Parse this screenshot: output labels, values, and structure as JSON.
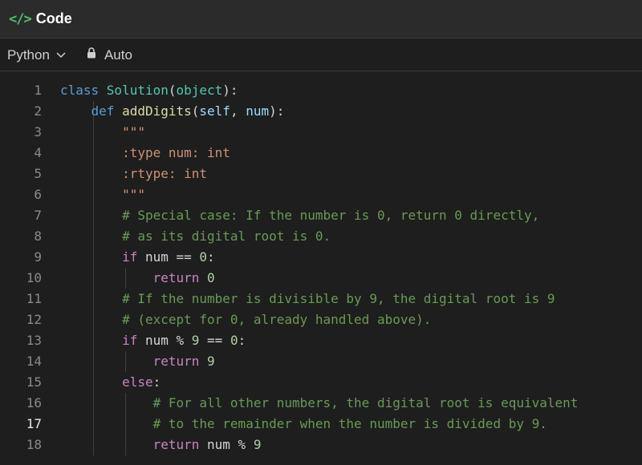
{
  "header": {
    "icon": "code-icon",
    "title": "Code"
  },
  "toolbar": {
    "language": "Python",
    "mode_label": "Auto"
  },
  "editor": {
    "active_line": 17,
    "lines": [
      {
        "n": "1",
        "tokens": [
          [
            "k",
            "class "
          ],
          [
            "cls",
            "Solution"
          ],
          [
            "pl",
            "("
          ],
          [
            "cls",
            "object"
          ],
          [
            "pl",
            "):"
          ]
        ]
      },
      {
        "n": "2",
        "tokens": [
          [
            "pl",
            "    "
          ],
          [
            "k",
            "def "
          ],
          [
            "fn",
            "addDigits"
          ],
          [
            "pl",
            "("
          ],
          [
            "pr",
            "self"
          ],
          [
            "pl",
            ", "
          ],
          [
            "pr",
            "num"
          ],
          [
            "pl",
            "):"
          ]
        ]
      },
      {
        "n": "3",
        "tokens": [
          [
            "pl",
            "        "
          ],
          [
            "str",
            "\"\"\""
          ]
        ]
      },
      {
        "n": "4",
        "tokens": [
          [
            "pl",
            "        "
          ],
          [
            "str",
            ":type num: int"
          ]
        ]
      },
      {
        "n": "5",
        "tokens": [
          [
            "pl",
            "        "
          ],
          [
            "str",
            ":rtype: int"
          ]
        ]
      },
      {
        "n": "6",
        "tokens": [
          [
            "pl",
            "        "
          ],
          [
            "str",
            "\"\"\""
          ]
        ]
      },
      {
        "n": "7",
        "tokens": [
          [
            "pl",
            "        "
          ],
          [
            "cm",
            "# Special case: If the number is 0, return 0 directly,"
          ]
        ]
      },
      {
        "n": "8",
        "tokens": [
          [
            "pl",
            "        "
          ],
          [
            "cm",
            "# as its digital root is 0."
          ]
        ]
      },
      {
        "n": "9",
        "tokens": [
          [
            "pl",
            "        "
          ],
          [
            "kw",
            "if"
          ],
          [
            "pl",
            " num == "
          ],
          [
            "num",
            "0"
          ],
          [
            "pl",
            ":"
          ]
        ]
      },
      {
        "n": "10",
        "tokens": [
          [
            "pl",
            "            "
          ],
          [
            "kw",
            "return "
          ],
          [
            "num",
            "0"
          ]
        ]
      },
      {
        "n": "11",
        "tokens": [
          [
            "pl",
            "        "
          ],
          [
            "cm",
            "# If the number is divisible by 9, the digital root is 9"
          ]
        ]
      },
      {
        "n": "12",
        "tokens": [
          [
            "pl",
            "        "
          ],
          [
            "cm",
            "# (except for 0, already handled above)."
          ]
        ]
      },
      {
        "n": "13",
        "tokens": [
          [
            "pl",
            "        "
          ],
          [
            "kw",
            "if"
          ],
          [
            "pl",
            " num % "
          ],
          [
            "num",
            "9"
          ],
          [
            "pl",
            " == "
          ],
          [
            "num",
            "0"
          ],
          [
            "pl",
            ":"
          ]
        ]
      },
      {
        "n": "14",
        "tokens": [
          [
            "pl",
            "            "
          ],
          [
            "kw",
            "return "
          ],
          [
            "num",
            "9"
          ]
        ]
      },
      {
        "n": "15",
        "tokens": [
          [
            "pl",
            "        "
          ],
          [
            "kw",
            "else"
          ],
          [
            "pl",
            ":"
          ]
        ]
      },
      {
        "n": "16",
        "tokens": [
          [
            "pl",
            "            "
          ],
          [
            "cm",
            "# For all other numbers, the digital root is equivalent"
          ]
        ]
      },
      {
        "n": "17",
        "tokens": [
          [
            "pl",
            "            "
          ],
          [
            "cm",
            "# to the remainder when the number is divided by 9."
          ]
        ]
      },
      {
        "n": "18",
        "tokens": [
          [
            "pl",
            "            "
          ],
          [
            "kw",
            "return"
          ],
          [
            "pl",
            " num % "
          ],
          [
            "num",
            "9"
          ]
        ]
      }
    ]
  }
}
